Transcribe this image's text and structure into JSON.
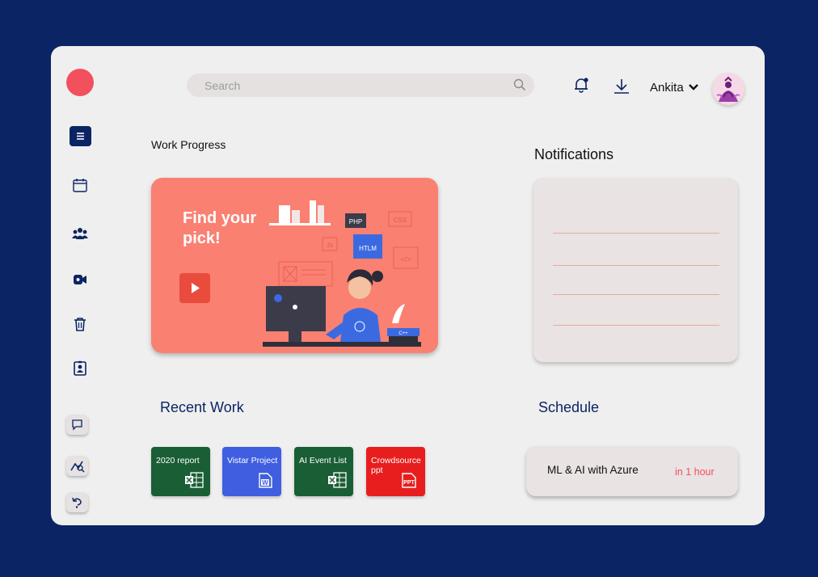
{
  "search": {
    "placeholder": "Search"
  },
  "header": {
    "user_name": "Ankita"
  },
  "sections": {
    "work_progress": "Work Progress",
    "notifications": "Notifications",
    "recent_work": "Recent Work",
    "schedule": "Schedule"
  },
  "banner": {
    "headline": "Find your pick!",
    "tags": [
      "PHP",
      "CSS",
      "Js",
      "HTLM",
      "C++"
    ]
  },
  "recent_files": [
    {
      "label": "2020 report",
      "type": "excel",
      "color": "#1a5e35"
    },
    {
      "label": "Vistar Project",
      "type": "word",
      "color": "#3f5ee0"
    },
    {
      "label": "AI Event List",
      "type": "excel",
      "color": "#1a5e35"
    },
    {
      "label": "Crowdsource ppt",
      "type": "ppt",
      "color": "#e81e1e"
    }
  ],
  "schedule": [
    {
      "title": "ML & AI with Azure",
      "time": "in 1 hour"
    }
  ],
  "sidebar": {
    "icons": [
      "menu-icon",
      "calendar-icon",
      "team-icon",
      "video-call-icon",
      "trash-icon",
      "contact-badge-icon",
      "chat-icon",
      "analytics-icon",
      "undo-icon"
    ]
  },
  "colors": {
    "background": "#0b2463",
    "accent": "#f2505d",
    "banner": "#fa8072"
  }
}
